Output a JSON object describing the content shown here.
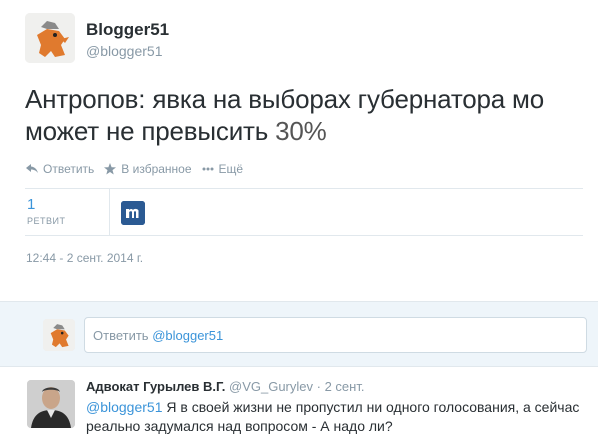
{
  "tweet": {
    "author_name": "Blogger51",
    "author_handle": "@blogger51",
    "text_main": "Антропов: явка на выборах губернатора мо может не превысить ",
    "text_number": "30%",
    "timestamp": "12:44 - 2 сент. 2014 г."
  },
  "actions": {
    "reply": "Ответить",
    "favorite": "В избранное",
    "more": "Ещё"
  },
  "stats": {
    "retweets_count": "1",
    "retweets_label": "РЕТВИТ"
  },
  "reply_box": {
    "prefix": "Ответить ",
    "mention": "@blogger51"
  },
  "reply": {
    "author_name": "Адвокат Гурылев В.Г.",
    "author_handle": "@VG_Gurylev",
    "time": "2 сент.",
    "separator": " · ",
    "mention": "@blogger51",
    "text": " Я в своей жизни не пропустил ни одного голосования, а сейчас реально задумался над вопросом - А надо ли?"
  },
  "colors": {
    "link": "#3b94d9",
    "muted": "#8899a6",
    "reply_bg": "#eef5fa"
  }
}
